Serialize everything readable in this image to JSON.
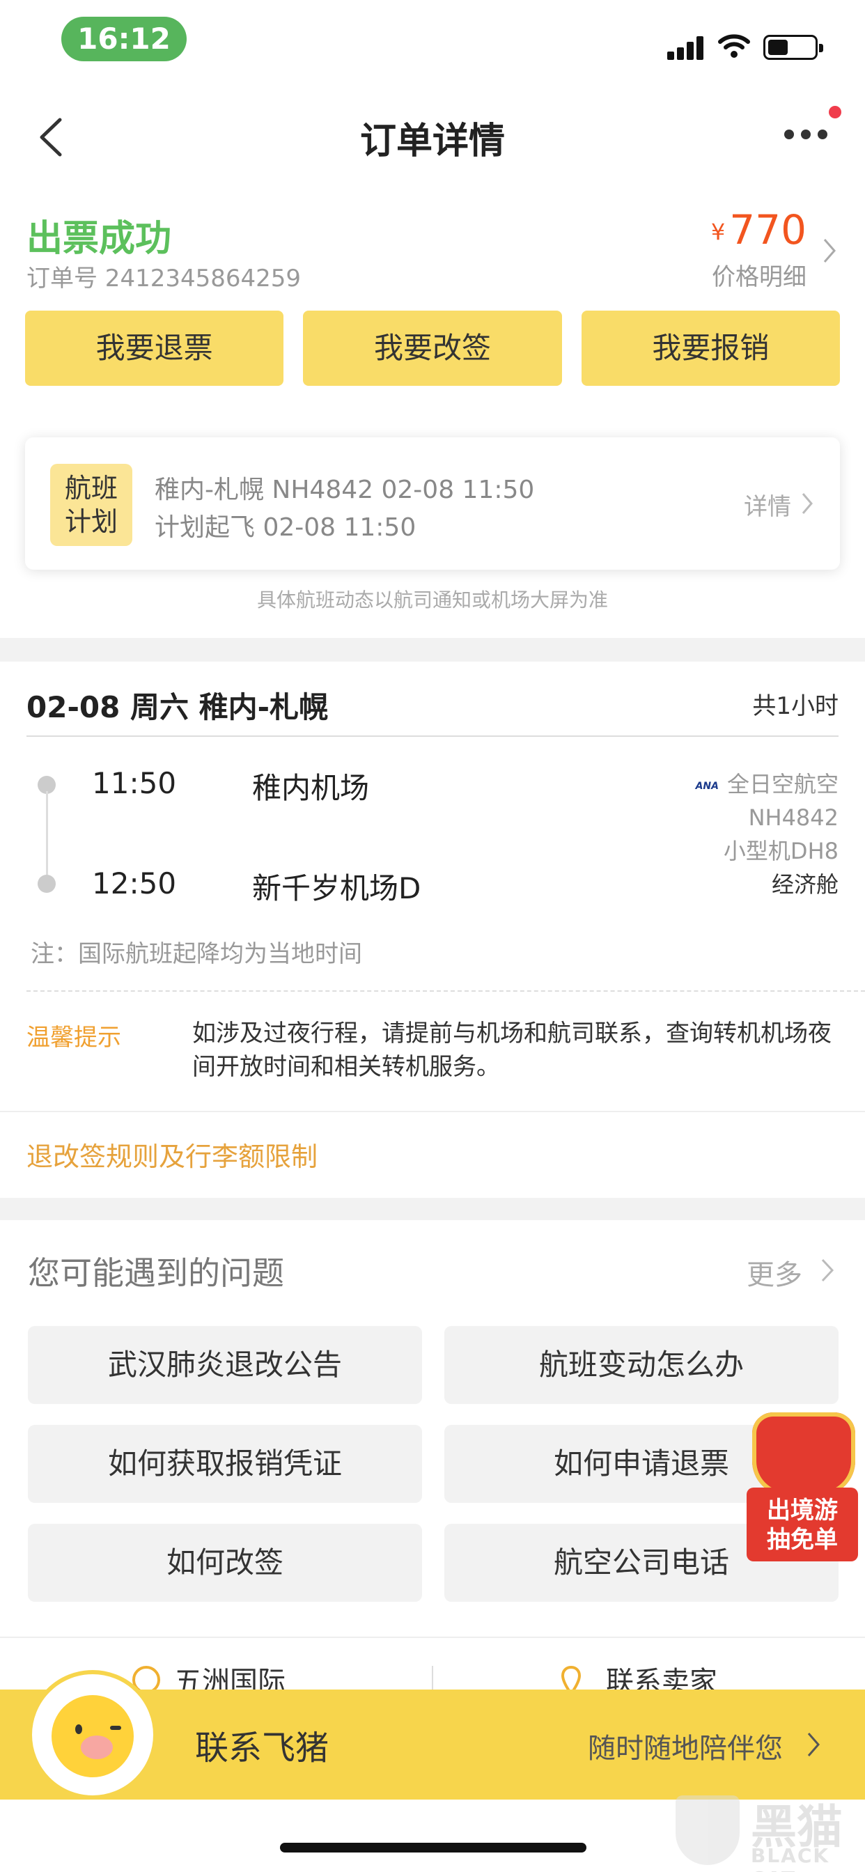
{
  "status_bar": {
    "time": "16:12"
  },
  "nav": {
    "title": "订单详情"
  },
  "order": {
    "status": "出票成功",
    "order_number": "订单号 2412345864259",
    "currency": "¥",
    "price": "770",
    "price_detail": "价格明细"
  },
  "actions": [
    "我要退票",
    "我要改签",
    "我要报销"
  ],
  "flight_plan": {
    "badge_line1": "航班",
    "badge_line2": "计划",
    "line1": "稚内-札幌 NH4842 02-08 11:50",
    "line2": "计划起飞 02-08 11:50",
    "detail": "详情"
  },
  "notice": "具体航班动态以航司通知或机场大屏为准",
  "flight": {
    "date_route": "02-08 周六 稚内-札幌",
    "duration": "共1小时",
    "dep_time": "11:50",
    "dep_airport": "稚内机场",
    "arr_time": "12:50",
    "arr_airport": "新千岁机场D",
    "airline_logo": "ANA",
    "airline": "全日空航空",
    "flight_no": "NH4842",
    "aircraft": "小型机DH8",
    "cabin": "经济舱",
    "note": "注：国际航班起降均为当地时间",
    "tip_label": "温馨提示",
    "tip_text": "如涉及过夜行程，请提前与机场和航司联系，查询转机机场夜间开放时间和相关转机服务。",
    "rules_link": "退改签规则及行李额限制"
  },
  "faq": {
    "title": "您可能遇到的问题",
    "more": "更多",
    "items": [
      "武汉肺炎退改公告",
      "航班变动怎么办",
      "如何获取报销凭证",
      "如何申请退票",
      "如何改签",
      "航空公司电话"
    ],
    "sub_left": "五洲国际",
    "sub_right": "联系卖家"
  },
  "promo": {
    "line1": "出境游",
    "line2": "抽免单"
  },
  "bottom": {
    "title": "联系飞猪",
    "subtitle": "随时随地陪伴您"
  },
  "watermark": {
    "cn": "黑猫",
    "en": "BLACK CAT"
  },
  "colors": {
    "accent_yellow": "#f9dc68",
    "success_green": "#5cc05c",
    "price_orange": "#f2551f",
    "tip_orange": "#f0a030"
  }
}
